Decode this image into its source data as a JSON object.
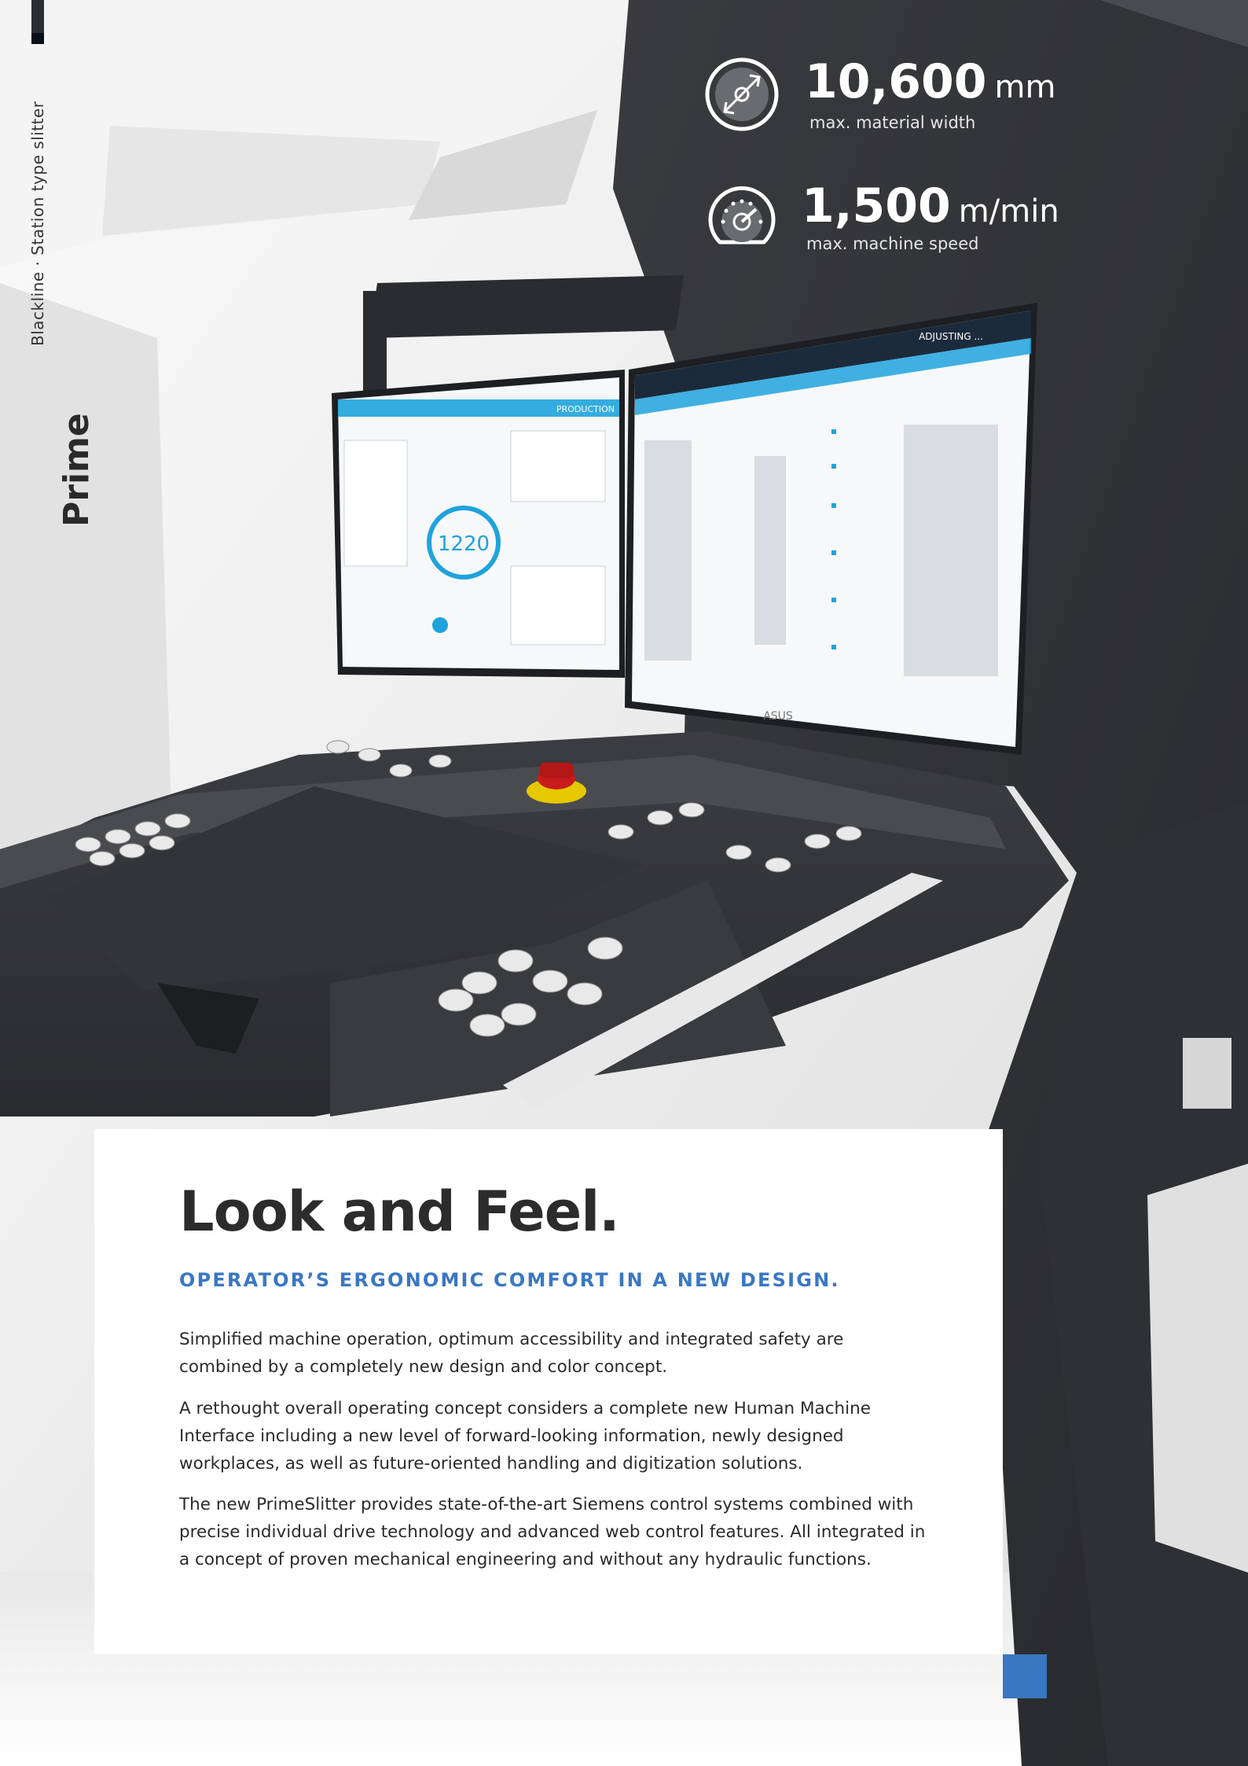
{
  "sidebar": {
    "category": "Blackline · Station type slitter"
  },
  "specs": [
    {
      "value": "10,600",
      "unit": "mm",
      "label": "max. material width",
      "icon": "width-arrows-icon"
    },
    {
      "value": "1,500",
      "unit": "m/min",
      "label": "max. machine speed",
      "icon": "speedometer-icon"
    }
  ],
  "article": {
    "title": "Look and Feel.",
    "subtitle": "OPERATOR’S ERGONOMIC COMFORT IN A NEW DESIGN.",
    "paragraphs": [
      "Simplified machine operation, optimum accessibility and integrated safety are combined by a completely new design and color concept.",
      "A rethought overall operating concept considers a complete new Human Machine Interface including a new level of forward-looking information, newly designed workplaces, as well as future-oriented handling and digitization solutions.",
      "The new PrimeSlitter provides state-of-the-art Siemens control systems combined with precise individual drive technology and advanced web control features. All integrated in a concept of proven mechanical engineering and without any hydraulic functions."
    ]
  },
  "photo": {
    "machine_label": "Prime",
    "screen_left_value": "1220",
    "screen_left_mode": "PRODUCTION",
    "screen_right_mode": "ADJUSTING ...",
    "monitor_brand": "ASUS"
  },
  "colors": {
    "accent_blue": "#3a77c2",
    "panel_dark": "#2f3033",
    "screen_cyan": "#1fa3dc"
  }
}
